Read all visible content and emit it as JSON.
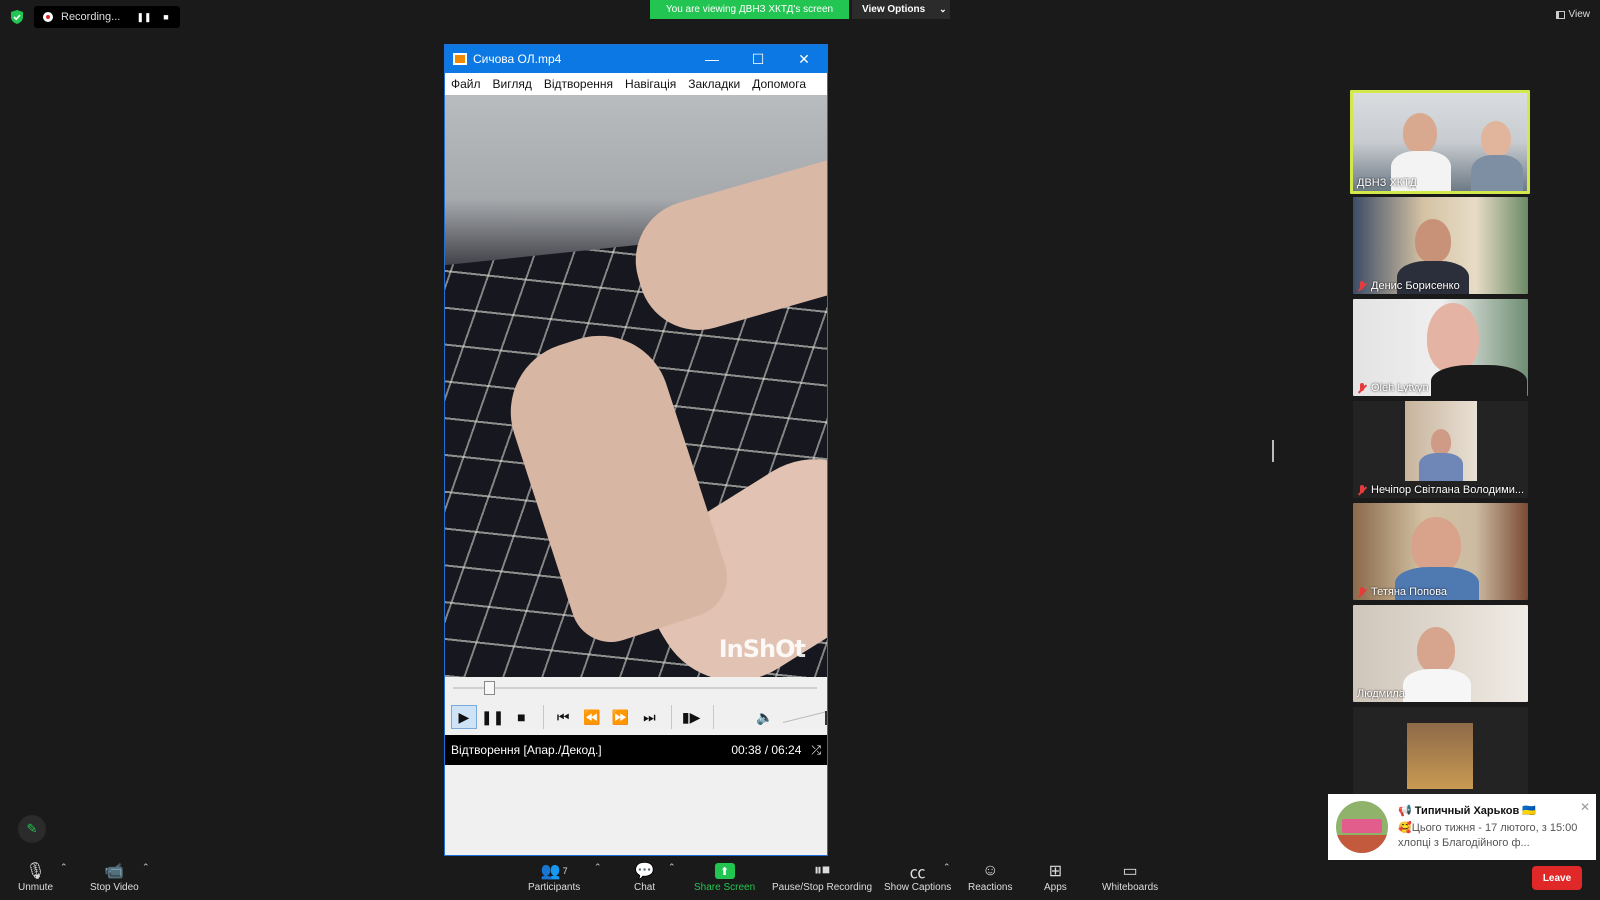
{
  "recording": {
    "label": "Recording..."
  },
  "banner": {
    "viewing": "You are viewing ДВНЗ ХКТД's screen",
    "view_options": "View Options"
  },
  "top_right": {
    "view_label": "View"
  },
  "player": {
    "title": "Сичова ОЛ.mp4",
    "menu": [
      "Файл",
      "Вигляд",
      "Відтворення",
      "Навігація",
      "Закладки",
      "Допомога"
    ],
    "watermark": "InShOt",
    "progress_fraction": 0.099,
    "status": "Відтворення [Апар./Декод.]",
    "time": "00:38 / 06:24"
  },
  "participants": [
    {
      "name": "ДВНЗ ХКТД",
      "muted": false,
      "active": true
    },
    {
      "name": "Денис Борисенко",
      "muted": true
    },
    {
      "name": "Oleh Lytvyn",
      "muted": true
    },
    {
      "name": "Нечіпор Світлана Володими...",
      "muted": true
    },
    {
      "name": "Тетяна Попова",
      "muted": true
    },
    {
      "name": "Людмила",
      "muted": false
    },
    {
      "name": "",
      "muted": false
    }
  ],
  "notification": {
    "title": "📢 Типичный Харьков 🇺🇦",
    "text": "🥰Цього тижня - 17 лютого, з 15:00 хлопці з Благодійного ф..."
  },
  "toolbar": {
    "unmute": "Unmute",
    "stop_video": "Stop Video",
    "participants": "Participants",
    "participants_count": "7",
    "chat": "Chat",
    "share_screen": "Share Screen",
    "pause_stop_recording": "Pause/Stop Recording",
    "show_captions": "Show Captions",
    "reactions": "Reactions",
    "apps": "Apps",
    "whiteboards": "Whiteboards",
    "leave": "Leave"
  },
  "colors": {
    "share_green": "#23c552",
    "leave_red": "#e02828",
    "active_speaker": "#d3e84a",
    "vlc_title": "#0b78e3"
  }
}
